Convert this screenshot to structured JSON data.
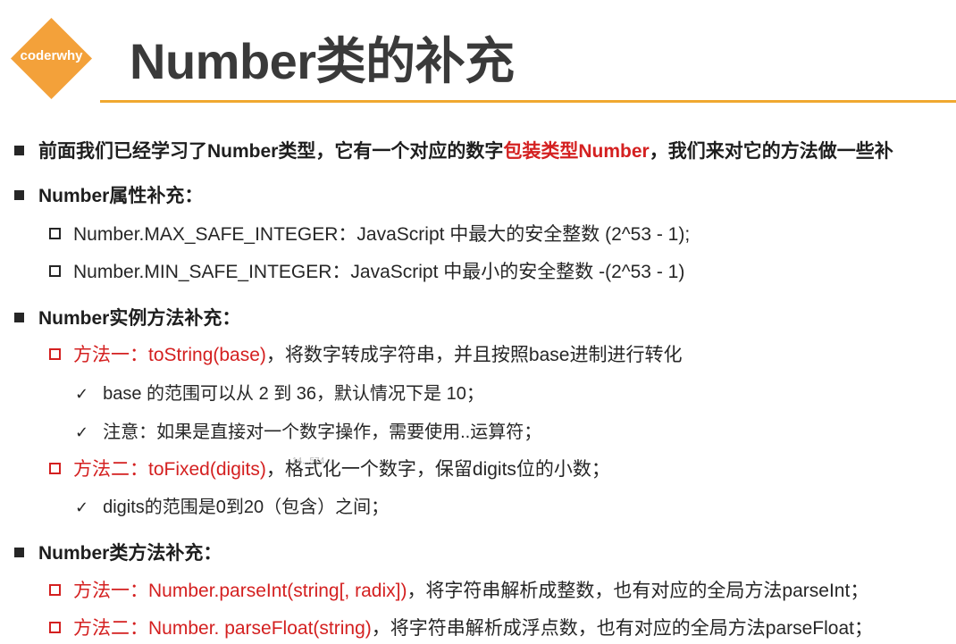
{
  "logo": {
    "text": "coderwhy"
  },
  "title": "Number类的补充",
  "content": {
    "intro": {
      "pre": "前面我们已经学习了Number类型，它有一个对应的数字",
      "highlight": "包装类型Number",
      "post": "，我们来对它的方法做一些补"
    },
    "props_heading": "Number属性补充：",
    "prop_max": "Number.MAX_SAFE_INTEGER：JavaScript 中最大的安全整数 (2^53 - 1);",
    "prop_min": "Number.MIN_SAFE_INTEGER：JavaScript 中最小的安全整数 -(2^53 - 1)",
    "instance_heading": "Number实例方法补充：",
    "tostring": {
      "label": "方法一：toString(base)",
      "desc": "，将数字转成字符串，并且按照base进制进行转化"
    },
    "tostring_note1": "base 的范围可以从 2 到 36，默认情况下是 10；",
    "tostring_note2": "注意：如果是直接对一个数字操作，需要使用..运算符；",
    "tofixed": {
      "label": "方法二：toFixed(digits)",
      "desc": "，格式化一个数字，保留digits位的小数；"
    },
    "tofixed_note": "digits的范围是0到20（包含）之间；",
    "static_heading": "Number类方法补充：",
    "parseint": {
      "label": "方法一：Number.parseInt(string[, radix])",
      "desc": "，将字符串解析成整数，也有对应的全局方法parseInt；"
    },
    "parsefloat": {
      "label": "方法二：Number. parseFloat(string)",
      "desc": "，将字符串解析成浮点数，也有对应的全局方法parseFloat；"
    }
  },
  "watermark": "14...574..."
}
